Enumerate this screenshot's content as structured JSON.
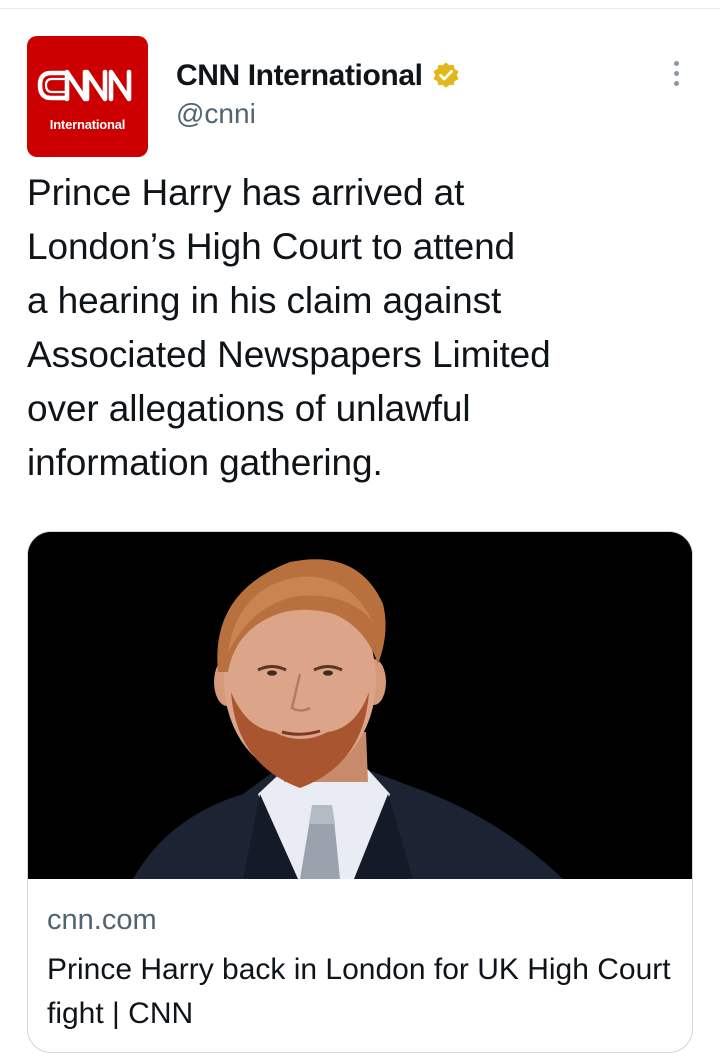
{
  "tweet": {
    "avatar": {
      "logo_text": "CNN",
      "logo_subtext": "International"
    },
    "author": {
      "display_name": "CNN International",
      "handle": "@cnni",
      "verified_badge": "verified-gold-badge-icon"
    },
    "menu_icon": "more-vertical-icon",
    "text": "Prince Harry has arrived at\nLondon’s High Court to attend\na hearing in his claim against\nAssociated Newspapers Limited\nover allegations of unlawful\ninformation gathering.",
    "link_card": {
      "domain": "cnn.com",
      "title": "Prince Harry back in London for UK High Court fight | CNN"
    }
  },
  "colors": {
    "cnn_red": "#cc0000",
    "verified_gold": "#e2b719",
    "secondary_text": "#536471",
    "card_border": "#cfd9de"
  }
}
